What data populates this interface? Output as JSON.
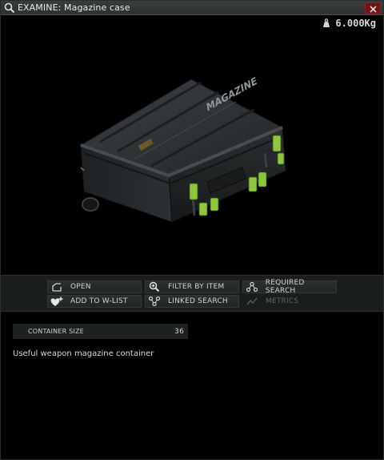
{
  "window": {
    "title": "EXAMINE: Magazine case",
    "close_label": "✕"
  },
  "item": {
    "weight": "6.000Kg",
    "case_stencil": "MAGAZINE",
    "accent_color": "#8ec63f",
    "body_color": "#2a2d2e"
  },
  "actions": {
    "open": "OPEN",
    "filter_by_item": "FILTER BY ITEM",
    "required_search": "REQUIRED SEARCH",
    "add_to_wishlist": "ADD TO W-LIST",
    "linked_search": "LINKED SEARCH",
    "metrics": "METRICS"
  },
  "stats": {
    "container_size_label": "CONTAINER SIZE",
    "container_size_value": "36"
  },
  "description": "Useful weapon magazine container"
}
